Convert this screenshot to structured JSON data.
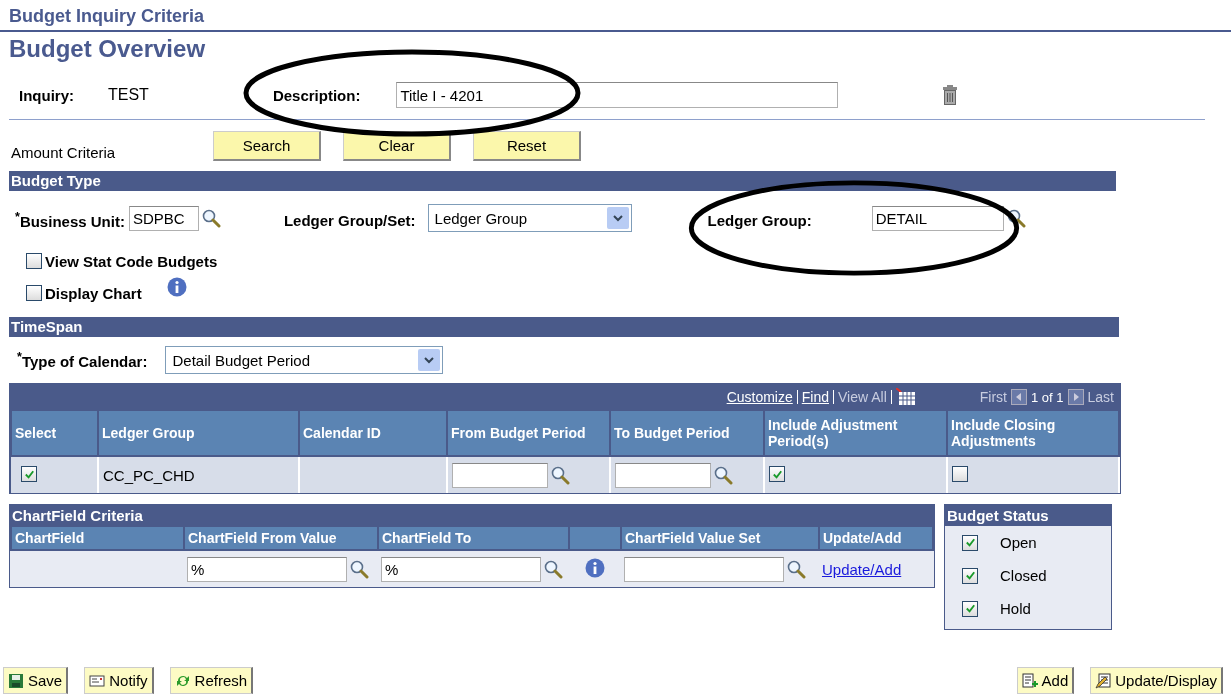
{
  "header": {
    "title": "Budget Inquiry Criteria",
    "page_title": "Budget Overview"
  },
  "inquiry": {
    "label": "Inquiry:",
    "value": "TEST",
    "description_label": "Description:",
    "description_value": "Title I - 4201"
  },
  "amount_criteria": {
    "label": "Amount Criteria",
    "buttons": [
      "Search",
      "Clear",
      "Reset"
    ]
  },
  "budget_type": {
    "title": "Budget Type",
    "business_unit_label": "$^{*}$Business Unit:",
    "business_unit": "SDPBC",
    "ledger_group_set_label": "Ledger Group/Set:",
    "ledger_group_set": "Ledger Group",
    "ledger_group_label": "Ledger Group:",
    "ledger_group": "DETAIL",
    "options": [
      {
        "label": "View Stat Code Budgets",
        "checked": false
      },
      {
        "label": "Display Chart",
        "checked": false
      }
    ]
  },
  "timespan": {
    "title": "TimeSpan",
    "calendar_label": "$^{*}$Type of Calendar:",
    "calendar": "Detail Budget Period",
    "grid": {
      "customize": "Customize",
      "find": "Find",
      "view_all": "View All",
      "first": "First",
      "page": "1 of 1",
      "last": "Last",
      "columns": [
        "Select",
        "Ledger Group",
        "Calendar ID",
        "From Budget Period",
        "To Budget Period",
        "Include Adjustment Period(s)",
        "Include Closing Adjustments"
      ],
      "rows": [
        {
          "selected": true,
          "ledger_group": "CC_PC_CHD",
          "include_adjustment": true,
          "include_closing": false
        }
      ]
    }
  },
  "chartfield_criteria": {
    "title": "ChartField Criteria",
    "columns": [
      "ChartField",
      "ChartField From Value",
      "ChartField To",
      "ChartField Value Set",
      "Update/Add"
    ],
    "rows": [
      {
        "from_value": "%",
        "to_value": "%",
        "link": "Update/Add"
      }
    ]
  },
  "budget_status": {
    "title": "Budget Status",
    "items": [
      {
        "label": "Open",
        "checked": true
      },
      {
        "label": "Closed",
        "checked": true
      },
      {
        "label": "Hold",
        "checked": true
      }
    ]
  },
  "footer": {
    "left": [
      {
        "kind": "save",
        "label": "Save"
      },
      {
        "kind": "notify",
        "label": "Notify"
      },
      {
        "kind": "refresh",
        "label": "Refresh"
      }
    ],
    "right": [
      {
        "kind": "add",
        "label": "Add"
      },
      {
        "kind": "update",
        "label": "Update/Display"
      }
    ]
  }
}
